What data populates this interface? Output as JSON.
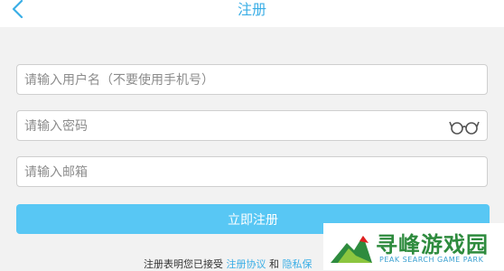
{
  "header": {
    "title": "注册",
    "back_icon": "chevron-left-icon"
  },
  "form": {
    "username_placeholder": "请输入用户名（不要使用手机号）",
    "password_placeholder": "请输入密码",
    "email_placeholder": "请输入邮箱",
    "show_password_icon": "glasses-icon",
    "submit_label": "立即注册"
  },
  "terms": {
    "prefix": "注册表明您已接受",
    "agreement_link": "注册协议",
    "conjunction": "和",
    "privacy_link": "隐私保"
  },
  "watermark": {
    "title": "寻峰游戏园",
    "subtitle": "PEAK SEARCH GAME PARK"
  },
  "colors": {
    "accent": "#3aaee6",
    "button": "#58c7f4",
    "background": "#f2f2f2"
  }
}
